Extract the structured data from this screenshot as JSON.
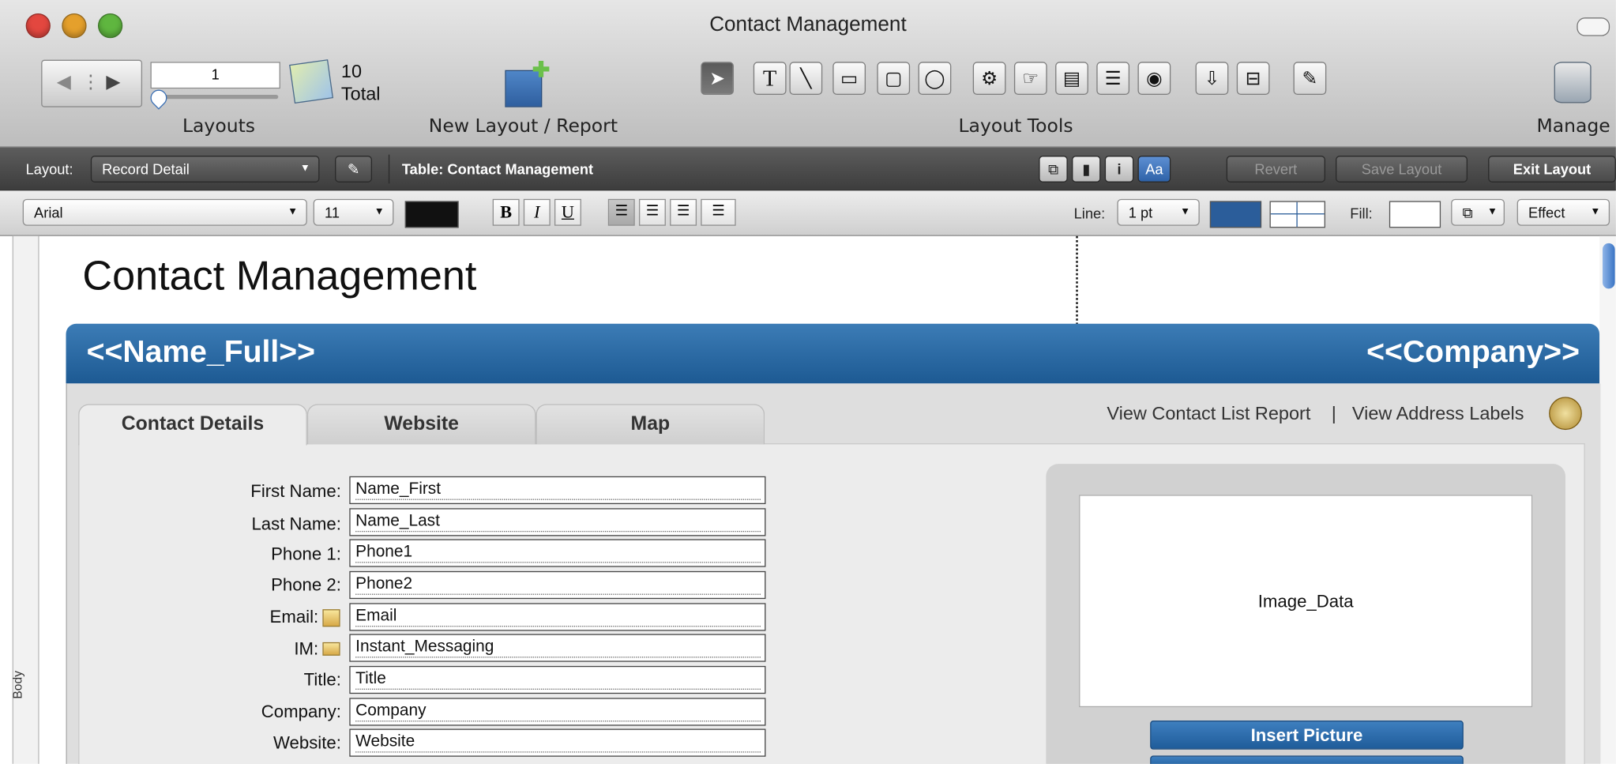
{
  "window": {
    "title": "Contact Management"
  },
  "toolbar": {
    "record_number": "1",
    "total_count": "10",
    "total_label": "Total",
    "layouts_label": "Layouts",
    "new_layout_label": "New Layout / Report",
    "layout_tools_label": "Layout Tools",
    "manage_label": "Manage",
    "text_tool": "T"
  },
  "layout_bar": {
    "layout_label": "Layout:",
    "layout_value": "Record Detail",
    "table_label": "Table: Contact Management",
    "aa_label": "Aa",
    "info_label": "i",
    "revert_label": "Revert",
    "save_layout_label": "Save Layout",
    "exit_layout_label": "Exit Layout"
  },
  "format_bar": {
    "font": "Arial",
    "size": "11",
    "bold": "B",
    "italic": "I",
    "underline": "U",
    "line_label": "Line:",
    "line_value": "1 pt",
    "fill_label": "Fill:",
    "effect_label": "Effect"
  },
  "canvas": {
    "part_label": "Body",
    "page_title": "Contact Management",
    "header_name": "<<Name_Full>>",
    "header_company": "<<Company>>",
    "tabs": [
      "Contact Details",
      "Website",
      "Map"
    ],
    "view_contact_list": "View Contact List Report",
    "separator": "|",
    "view_address_labels": "View Address Labels",
    "fields": [
      {
        "label": "First Name:",
        "value": "Name_First"
      },
      {
        "label": "Last Name:",
        "value": "Name_Last"
      },
      {
        "label": "Phone 1:",
        "value": "Phone1"
      },
      {
        "label": "Phone 2:",
        "value": "Phone2"
      },
      {
        "label": "Email:",
        "value": "Email"
      },
      {
        "label": "IM:",
        "value": "Instant_Messaging"
      },
      {
        "label": "Title:",
        "value": "Title"
      },
      {
        "label": "Company:",
        "value": "Company"
      },
      {
        "label": "Website:",
        "value": "Website"
      }
    ],
    "image_field": "Image_Data",
    "insert_picture": "Insert Picture"
  },
  "colors": {
    "header_blue": "#2a6aa6",
    "dark_bar": "#4a4a4a",
    "accent_blue": "#2e62a8"
  }
}
